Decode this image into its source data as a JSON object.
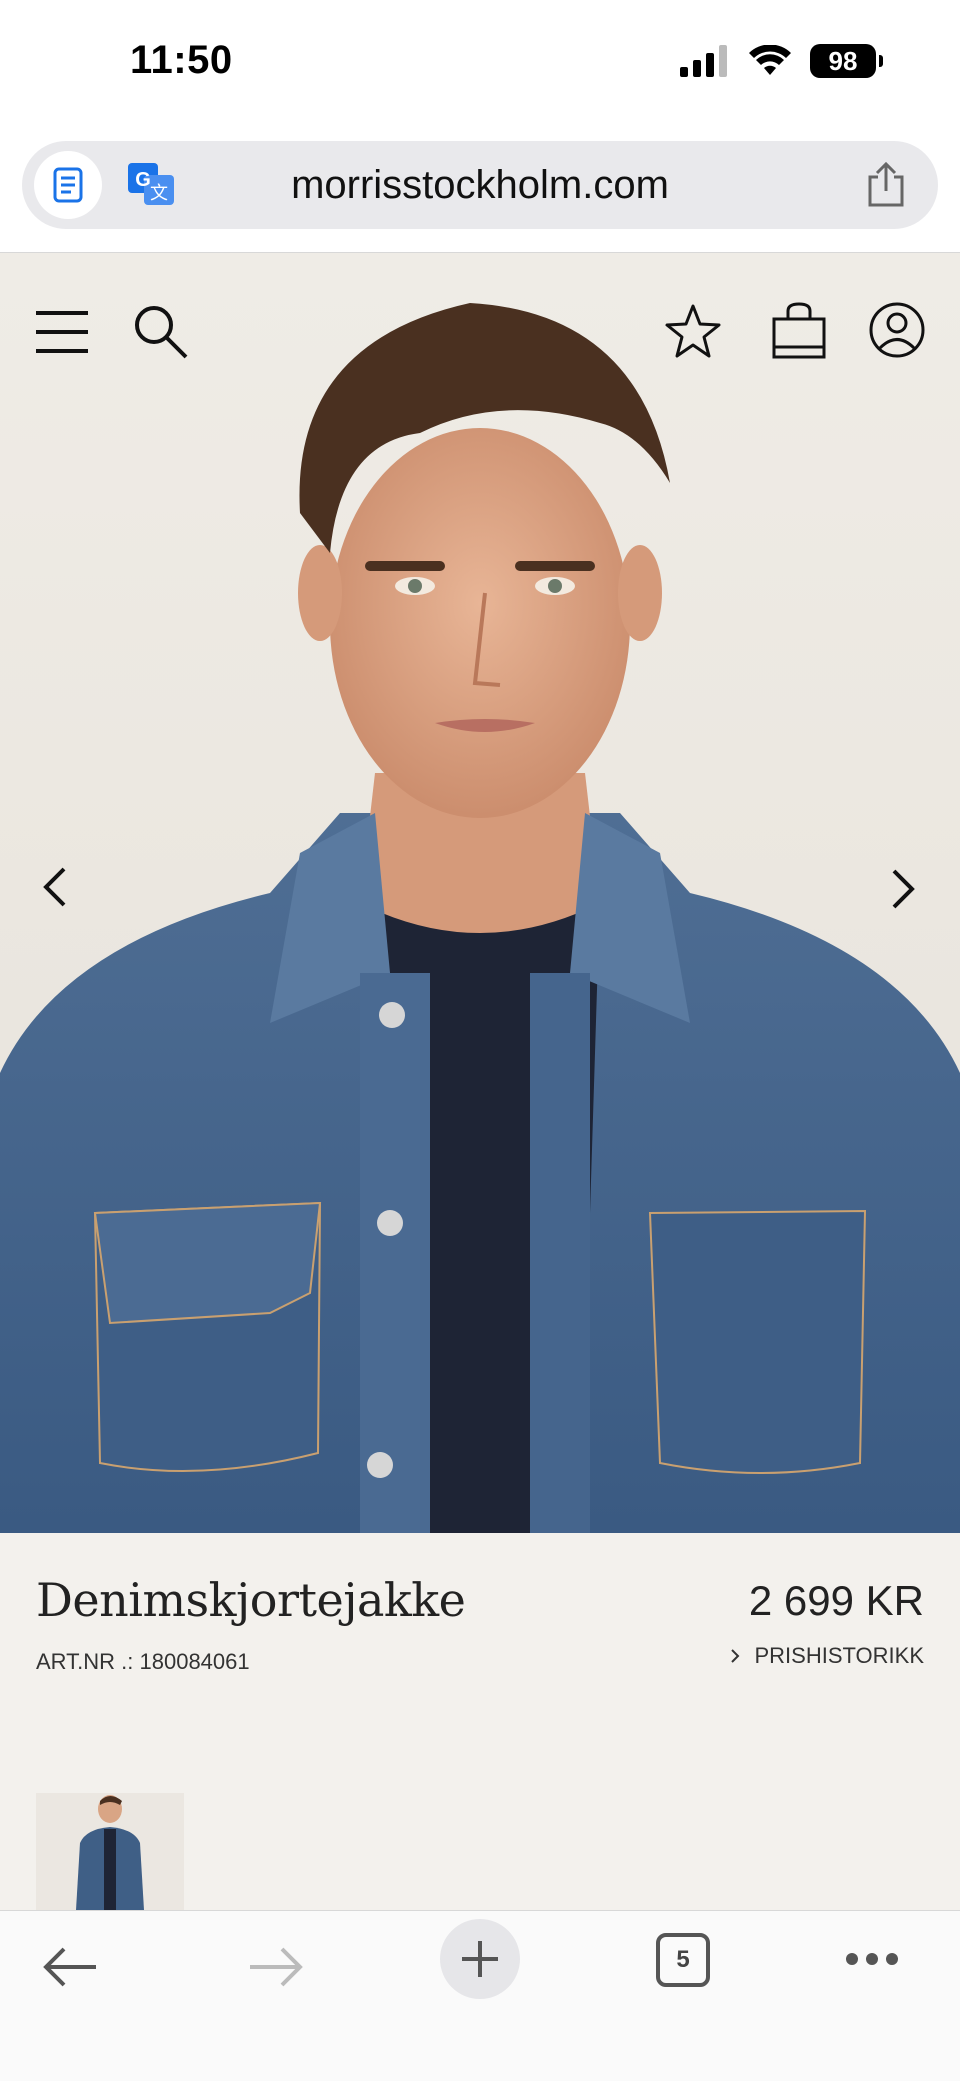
{
  "status_bar": {
    "time": "11:50",
    "battery": "98",
    "icons": [
      "cellular-signal-icon",
      "wifi-icon",
      "battery-icon"
    ]
  },
  "browser": {
    "url": "morrisstockholm.com",
    "icons": [
      "reader-mode-icon",
      "translate-icon",
      "share-icon"
    ]
  },
  "site_header": {
    "icons": [
      "menu-icon",
      "search-icon",
      "wishlist-star-icon",
      "shopping-bag-icon",
      "account-icon"
    ]
  },
  "gallery": {
    "image": "product-photo-model-denim-jacket",
    "icons": [
      "chevron-left-icon",
      "chevron-right-icon"
    ]
  },
  "product": {
    "name": "Denimskjortejakke",
    "art_number": "ART.NR .: 180084061",
    "price": "2 699 KR",
    "price_history_label": "PRISHISTORIKK"
  },
  "toolbar": {
    "tabs_count": "5",
    "icons": [
      "back-arrow-icon",
      "forward-arrow-icon",
      "plus-icon",
      "tabs-icon",
      "more-icon"
    ]
  },
  "colors": {
    "page_background": "#f3f1ed",
    "denim": "#3f5f86",
    "sweater": "#1e2435",
    "hair": "#4a3020",
    "text": "#1d1d1d"
  }
}
